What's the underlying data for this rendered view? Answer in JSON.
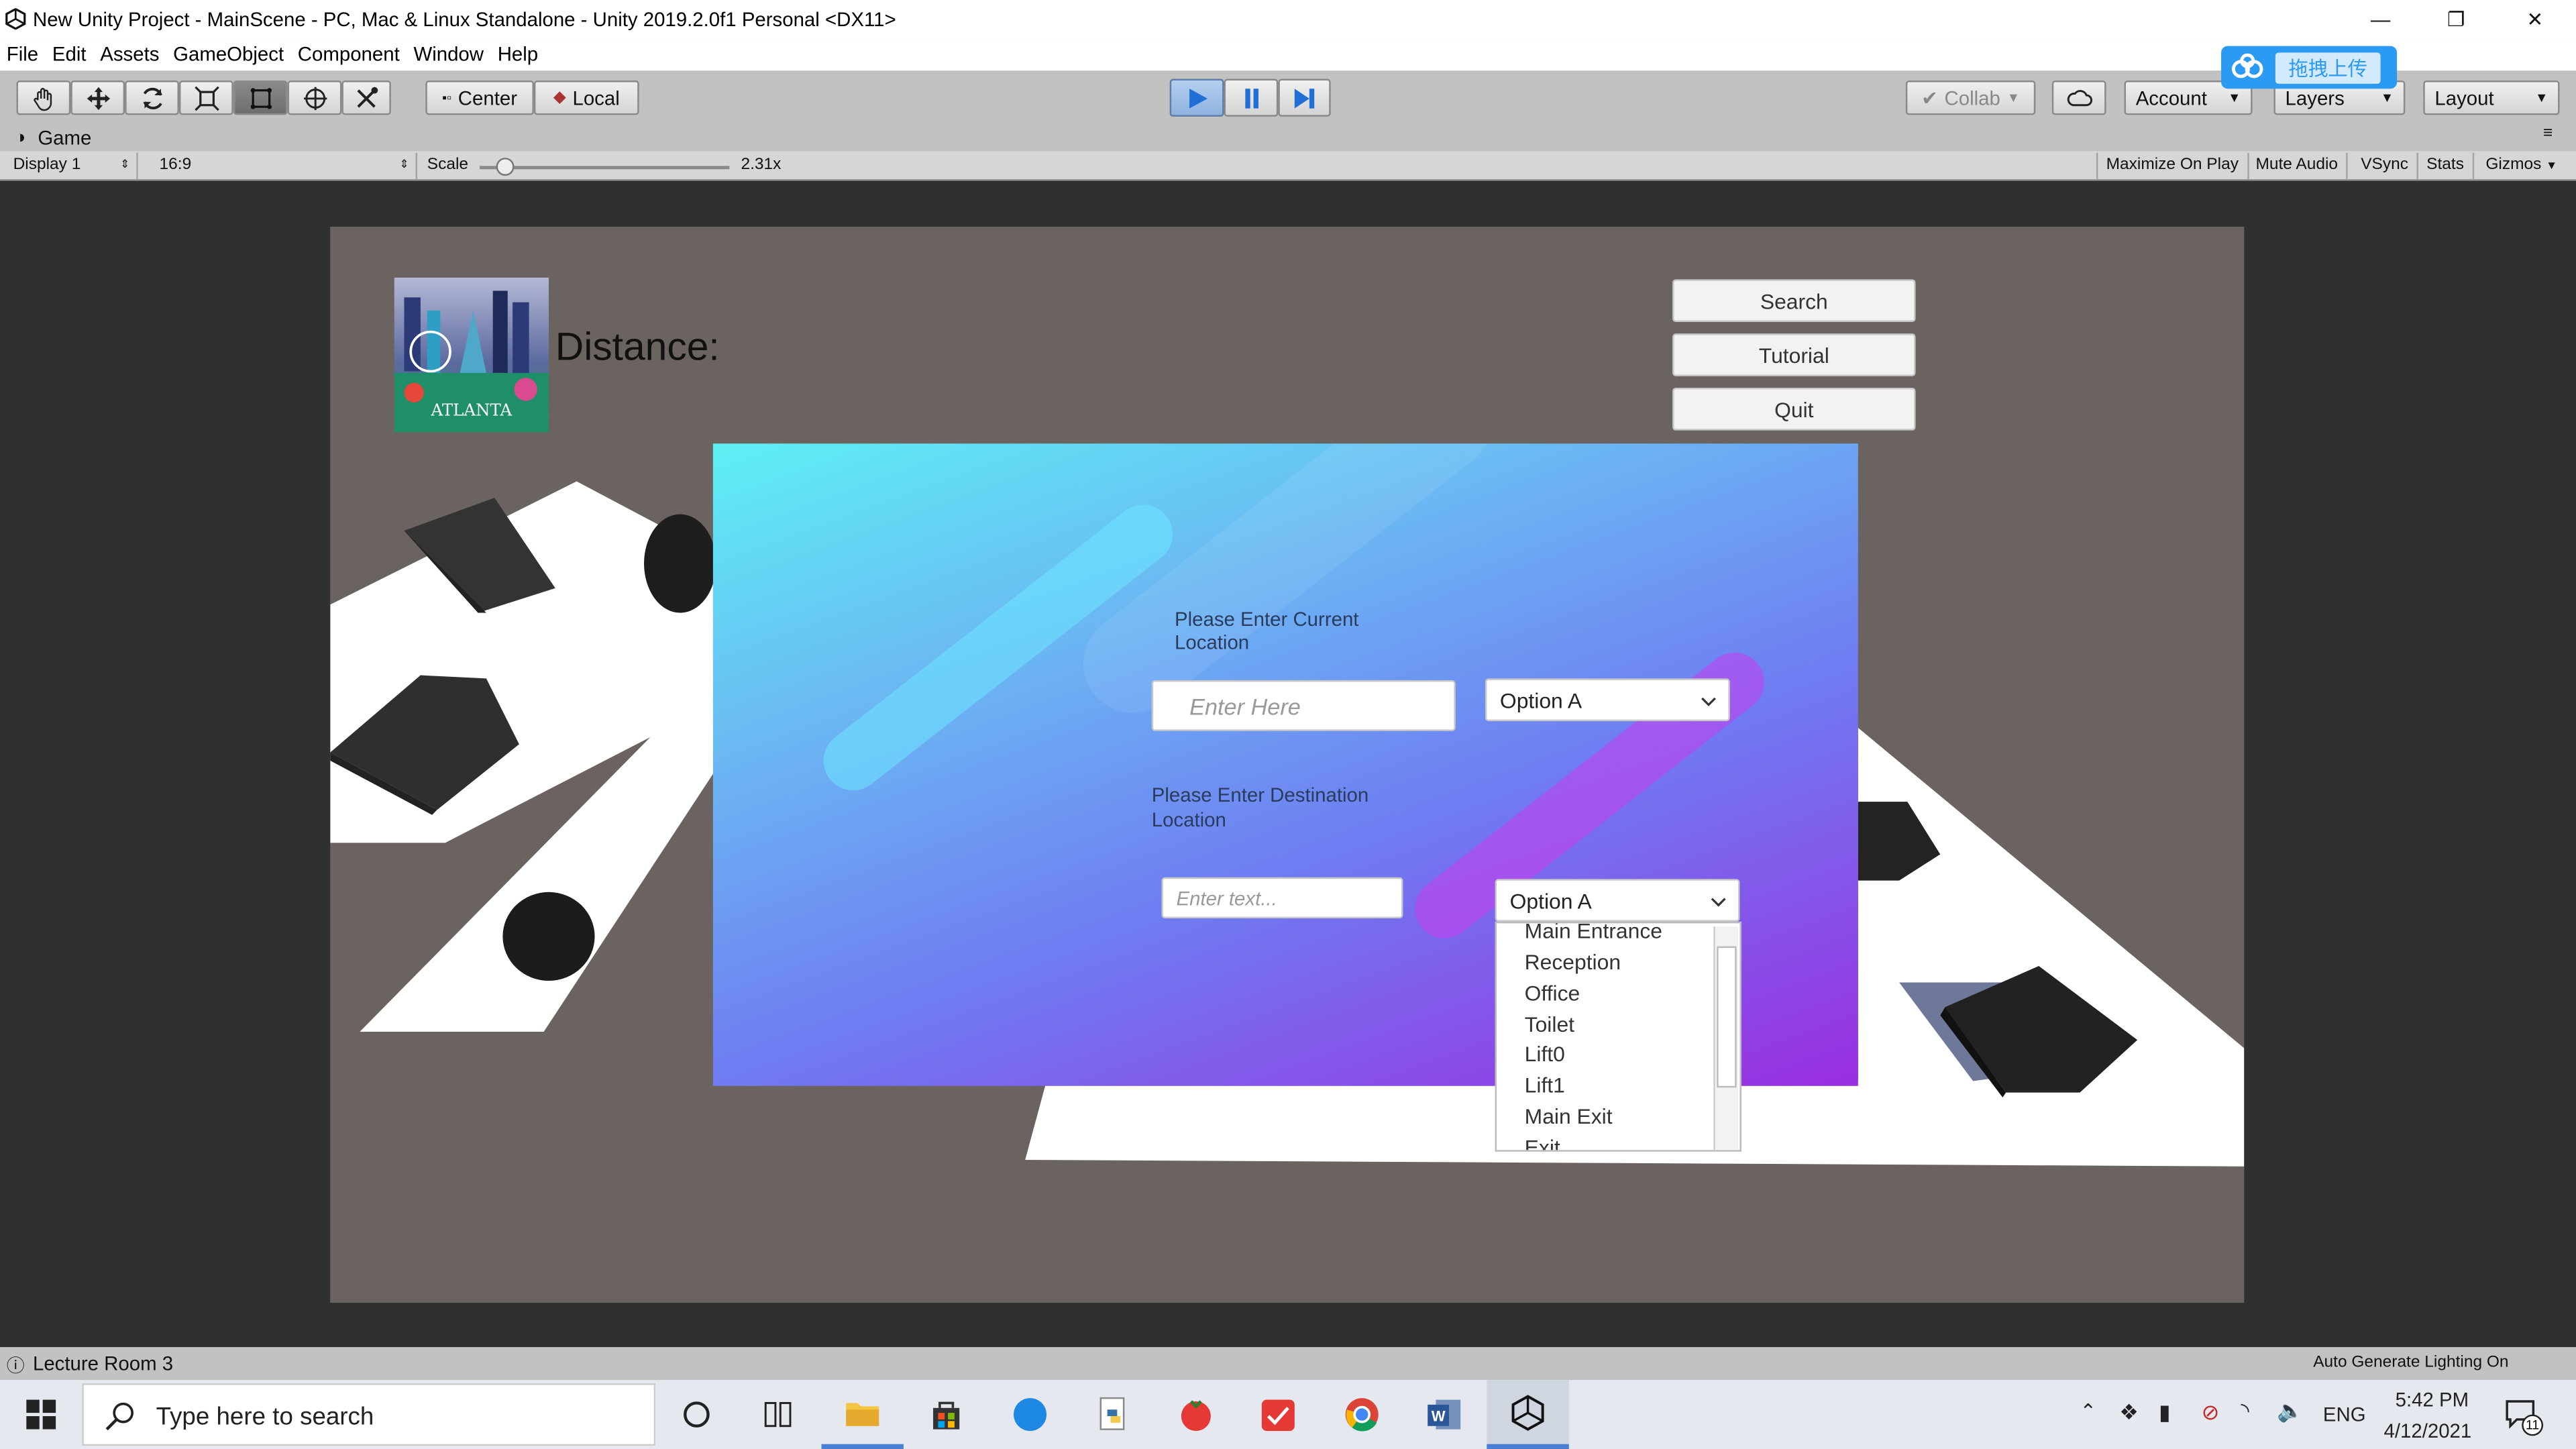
{
  "window": {
    "title": "New Unity Project - MainScene - PC, Mac & Linux Standalone - Unity 2019.2.0f1 Personal <DX11>"
  },
  "menu": [
    "File",
    "Edit",
    "Assets",
    "GameObject",
    "Component",
    "Window",
    "Help"
  ],
  "toolbar": {
    "pivot_label": "Center",
    "space_label": "Local",
    "collab_label": "Collab",
    "account_label": "Account",
    "layers_label": "Layers",
    "layout_label": "Layout"
  },
  "upload_widget": {
    "label": "拖拽上传"
  },
  "game_tab": {
    "title": "Game",
    "display": "Display 1",
    "aspect": "16:9",
    "scale_label": "Scale",
    "scale_value": "2.31x",
    "scale_slider_fraction": 0.1,
    "maximize": "Maximize On Play",
    "mute": "Mute Audio",
    "vsync": "VSync",
    "stats": "Stats",
    "gizmos": "Gizmos"
  },
  "game_ui": {
    "logo_text": "ATLANTA",
    "distance_label": "Distance:",
    "buttons": {
      "search": "Search",
      "tutorial": "Tutorial",
      "quit": "Quit"
    },
    "current_prompt": "Please Enter Current Location",
    "current_placeholder": "Enter Here",
    "current_dropdown": "Option A",
    "dest_prompt": "Please Enter Destination Location",
    "dest_placeholder": "Enter text...",
    "dest_dropdown": "Option A",
    "dest_options": [
      "Main Entrance",
      "Reception",
      "Office",
      "Toilet",
      "Lift0",
      "Lift1",
      "Main Exit",
      "Exit"
    ]
  },
  "status": {
    "scene": "Lecture Room 3",
    "lighting": "Auto Generate Lighting On"
  },
  "taskbar": {
    "search_placeholder": "Type here to search",
    "language": "ENG",
    "time": "5:42 PM",
    "date": "4/12/2021",
    "notifications": "11"
  },
  "colors": {
    "panel_gradient_start": "#5ef0f4",
    "panel_gradient_mid": "#6f7cf2",
    "panel_gradient_end": "#9a2ee0",
    "editor_gray": "#c2c2c2",
    "play_blue": "#8fb2e0",
    "upload_blue": "#2b9af3"
  }
}
